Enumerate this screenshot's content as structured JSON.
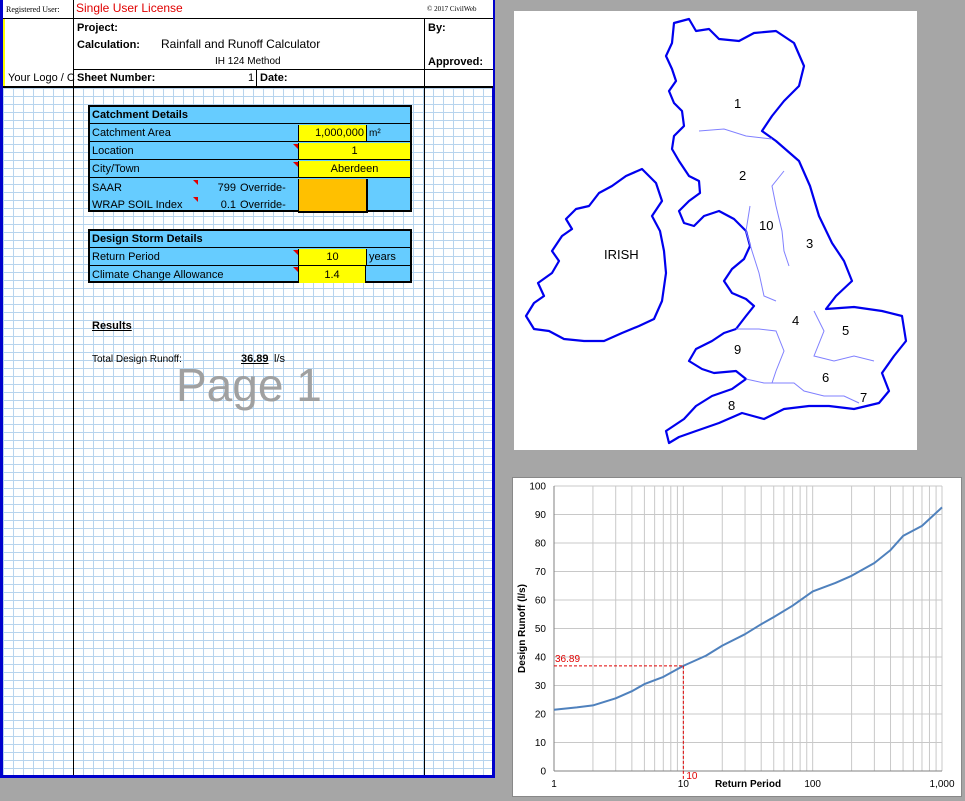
{
  "header": {
    "registered_user_label": "Registered User:",
    "license": "Single User License",
    "copyright": "© 2017 CivilWeb",
    "logo_placeholder": "Your Logo / C",
    "project_label": "Project:",
    "calculation_label": "Calculation:",
    "calculation_value": "Rainfall and Runoff Calculator",
    "method": "IH 124 Method",
    "sheet_number_label": "Sheet Number:",
    "sheet_number_value": "1",
    "date_label": "Date:",
    "by_label": "By:",
    "approved_label": "Approved:"
  },
  "catchment": {
    "title": "Catchment Details",
    "area_label": "Catchment Area",
    "area_value": "1,000,000",
    "area_unit": "m²",
    "location_label": "Location",
    "location_value": "1",
    "city_label": "City/Town",
    "city_value": "Aberdeen",
    "saar_label": "SAAR",
    "saar_value": "799",
    "override_label": "Override-",
    "wrap_label": "WRAP SOIL Index",
    "wrap_value": "0.1"
  },
  "storm": {
    "title": "Design Storm Details",
    "return_label": "Return Period",
    "return_value": "10",
    "return_unit": "years",
    "climate_label": "Climate Change Allowance",
    "climate_value": "1.4"
  },
  "results": {
    "title": "Results",
    "runoff_label": "Total Design Runoff:",
    "runoff_value": "36.89",
    "runoff_unit": "l/s"
  },
  "watermark": "Page 1",
  "map": {
    "label_irish": "IRISH",
    "regions": [
      "1",
      "2",
      "3",
      "4",
      "5",
      "6",
      "7",
      "8",
      "9",
      "10"
    ],
    "outline_color": "#0000ee",
    "region_line_color": "#8080ff"
  },
  "chart_data": {
    "type": "line",
    "xlabel": "Return Period",
    "ylabel": "Design Runoff  (l/s)",
    "xscale": "log",
    "xlim": [
      1,
      1000
    ],
    "ylim": [
      0,
      100
    ],
    "xticks": [
      "1",
      "10",
      "100",
      "1,000"
    ],
    "yticks": [
      "0",
      "10",
      "20",
      "30",
      "40",
      "50",
      "60",
      "70",
      "80",
      "90",
      "100"
    ],
    "grid": true,
    "x": [
      1,
      1.5,
      2,
      3,
      4,
      5,
      7,
      10,
      15,
      20,
      30,
      40,
      50,
      70,
      100,
      150,
      200,
      300,
      400,
      500,
      700,
      1000
    ],
    "y": [
      21.5,
      22.3,
      23,
      25.5,
      28,
      30.5,
      33,
      36.89,
      40.5,
      44,
      48,
      51.5,
      54,
      58,
      63,
      66,
      68.5,
      73,
      77.5,
      82.5,
      86,
      92.5
    ],
    "line_color": "#4f81bd",
    "marker": {
      "x": 10,
      "y": 36.89,
      "x_label": "10",
      "y_label": "36.89",
      "color": "#e00000"
    }
  }
}
